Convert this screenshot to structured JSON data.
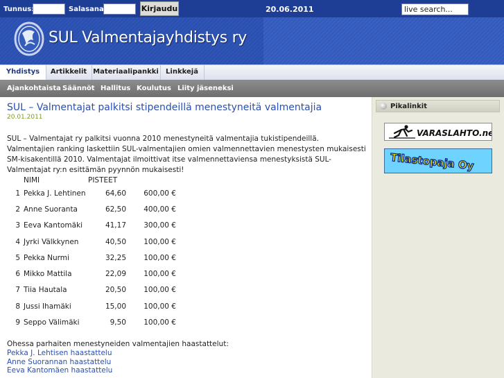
{
  "topbar": {
    "username_label": "Tunnus:",
    "password_label": "Salasana:",
    "login_button": "Kirjaudu",
    "date": "20.06.2011",
    "search_placeholder": "live search..."
  },
  "header": {
    "site_title": "SUL Valmentajayhdistys ry"
  },
  "nav": {
    "items": [
      {
        "label": "Yhdistys",
        "active": true
      },
      {
        "label": "Artikkelit",
        "active": false
      },
      {
        "label": "Materiaalipankki",
        "active": false
      },
      {
        "label": "Linkkejä",
        "active": false
      }
    ]
  },
  "subnav": {
    "items": [
      "Ajankohtaista",
      "Säännöt",
      "Hallitus",
      "Koulutus",
      "Liity jäseneksi"
    ]
  },
  "article": {
    "title": "SUL – Valmentajat palkitsi stipendeillä menestyneitä valmentajia",
    "date": "20.01.2011",
    "body": "SUL – Valmentajat ry palkitsi vuonna 2010 menestyneitä valmentajia tukistipendeillä. Valmentajien ranking laskettiin SUL-valmentajien omien valmennettavien menestysten mukaisesti SM-kisakentillä 2010. Valmentajat ilmoittivat itse valmennettaviensa menestyksistä SUL-Valmentajat ry:n esittämän pyynnön mukaisesti!",
    "table": {
      "headers": {
        "name": "NIMI",
        "points": "PISTEET"
      },
      "rows": [
        {
          "rank": "1",
          "name": "Pekka J. Lehtinen",
          "points": "64,60",
          "amount": "600,00 €"
        },
        {
          "rank": "2",
          "name": "Anne Suoranta",
          "points": "62,50",
          "amount": "400,00 €"
        },
        {
          "rank": "3",
          "name": "Eeva Kantomäki",
          "points": "41,17",
          "amount": "300,00 €"
        },
        {
          "rank": "4",
          "name": "Jyrki Välkkynen",
          "points": "40,50",
          "amount": "100,00 €"
        },
        {
          "rank": "5",
          "name": "Pekka Nurmi",
          "points": "32,25",
          "amount": "100,00 €"
        },
        {
          "rank": "6",
          "name": "Mikko Mattila",
          "points": "22,09",
          "amount": "100,00 €"
        },
        {
          "rank": "7",
          "name": "Tiia Hautala",
          "points": "20,50",
          "amount": "100,00 €"
        },
        {
          "rank": "8",
          "name": "Jussi Ihamäki",
          "points": "15,00",
          "amount": "100,00 €"
        },
        {
          "rank": "9",
          "name": "Seppo Välimäki",
          "points": "9,50",
          "amount": "100,00 €"
        }
      ]
    },
    "outro": "Ohessa parhaiten menestyneiden valmentajien haastattelut:",
    "interview_links": [
      "Pekka J. Lehtisen haastattelu",
      "Anne Suorannan haastattelu",
      "Eeva Kantomäen haastattelu"
    ]
  },
  "sidebar": {
    "title": "Pikalinkit",
    "banners": [
      {
        "name": "varaslahto-banner",
        "text": "VARASLAHTO.net"
      },
      {
        "name": "tilastopaja-banner",
        "text": "Tilastopaja Oy"
      }
    ]
  },
  "colors": {
    "topbar": "#1e3e95",
    "header": "#2f55b6",
    "link": "#2a4fae",
    "date_green": "#7a9b1e",
    "sidebar_bg": "#eaebde"
  }
}
